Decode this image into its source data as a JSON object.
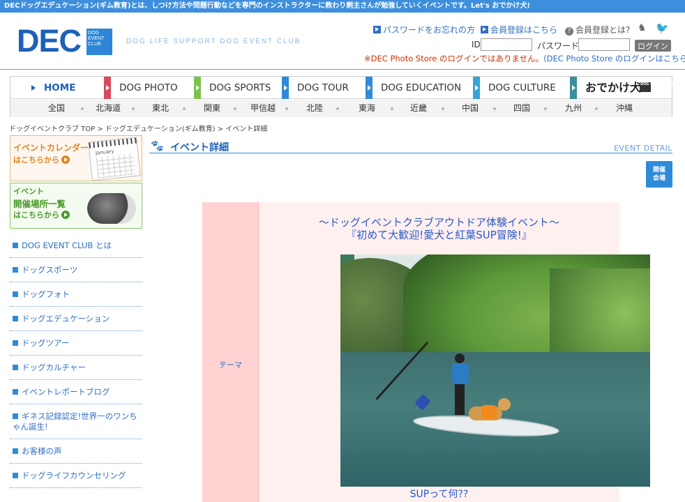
{
  "topbar": {
    "text": "DECドッグエデュケーション(ギム教育)とは、しつけ方法や問題行動などを専門のインストラクターに教わり飼主さんが勉強していくイベントです。Let's おでかけ犬!"
  },
  "header": {
    "logo": "DEC",
    "logo_box": [
      "DOG",
      "EVENT",
      "CLUB"
    ],
    "tagline": "DOG LIFE SUPPORT DOG EVENT CLUB",
    "forgot_password": "パスワードをお忘れの方",
    "register": "会員登録はこちら",
    "what_is_member": "会員登録とは?",
    "id_label": "ID",
    "password_label": "パスワード",
    "login_button": "ログイン",
    "notice_prefix": "※DEC Photo Store のログインではありません。",
    "notice_link": "(DEC Photo Store のログインはこちら)"
  },
  "nav": {
    "main": [
      {
        "label": "HOME"
      },
      {
        "label": "DOG PHOTO",
        "color": "#d84a5a"
      },
      {
        "label": "DOG SPORTS",
        "color": "#7cc24a"
      },
      {
        "label": "DOG TOUR",
        "color": "#2f8ad9"
      },
      {
        "label": "DOG EDUCATION",
        "color": "#2f8ad9"
      },
      {
        "label": "DOG CULTURE",
        "color": "#3aa3d8"
      },
      {
        "label": "おでかけ犬",
        "color": "#3a8f9a"
      }
    ],
    "odekake_badge": "DOG EVENT CLUB",
    "regions": [
      "全国",
      "北海道",
      "東北",
      "関東",
      "甲信越",
      "北陸",
      "東海",
      "近畿",
      "中国",
      "四国",
      "九州",
      "沖縄"
    ]
  },
  "breadcrumb": "ドッグイベントクラブ TOP > ドッグエデュケーション(ギム教育) > イベント詳細",
  "banners": {
    "calendar_1": "イベントカレンダー",
    "calendar_2": "はこちらから",
    "calendar_month": "January",
    "venue_1": "イベント",
    "venue_2": "開催場所一覧",
    "venue_3": "はこちらから"
  },
  "sidemenu": [
    "DOG EVENT CLUB とは",
    "ドッグスポーツ",
    "ドッグフォト",
    "ドッグエデュケーション",
    "ドッグツアー",
    "ドッグカルチャー",
    "イベントレポートブログ",
    "ギネス記録認定!世界一のワンちゃん誕生!",
    "お客様の声",
    "ドッグライフカウンセリング"
  ],
  "main": {
    "title": "イベント詳細",
    "title_en": "EVENT DETAIL",
    "venue_button": [
      "開催",
      "会場"
    ],
    "theme_label": "テーマ",
    "event_subtitle": "〜ドッグイベントクラブアウトドア体験イベント〜",
    "event_title": "『初めて大歓迎!愛犬と紅葉SUP冒険!』",
    "photo_alt": "SUP",
    "sup_heading": "SUPって何??"
  }
}
